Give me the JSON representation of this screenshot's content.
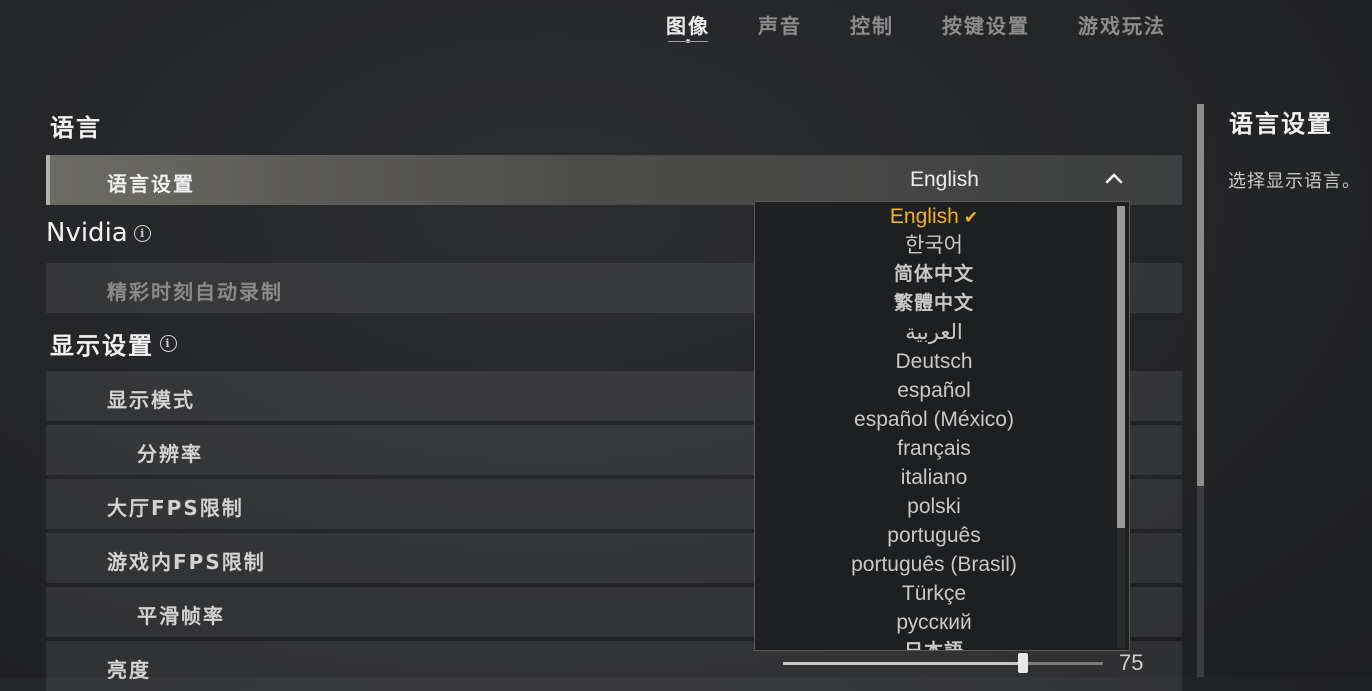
{
  "tabs": [
    {
      "label": "图像",
      "active": true
    },
    {
      "label": "声音",
      "active": false
    },
    {
      "label": "控制",
      "active": false
    },
    {
      "label": "按键设置",
      "active": false
    },
    {
      "label": "游戏玩法",
      "active": false
    }
  ],
  "sections": {
    "language": "语言",
    "nvidia": "Nvidia",
    "display": "显示设置"
  },
  "rows": {
    "language_setting": {
      "label": "语言设置",
      "value": "English"
    },
    "highlights_auto_record": "精彩时刻自动录制",
    "display_mode": "显示模式",
    "resolution": "分辨率",
    "lobby_fps_limit": "大厅FPS限制",
    "ingame_fps_limit": "游戏内FPS限制",
    "smooth_framerate": "平滑帧率",
    "brightness": {
      "label": "亮度",
      "value": "75",
      "level_percent": 75
    }
  },
  "language_options": [
    {
      "label": "English",
      "selected": true
    },
    {
      "label": "한국어"
    },
    {
      "label": "简体中文"
    },
    {
      "label": "繁體中文"
    },
    {
      "label": "العربية"
    },
    {
      "label": "Deutsch"
    },
    {
      "label": "español"
    },
    {
      "label": "español (México)"
    },
    {
      "label": "français"
    },
    {
      "label": "italiano"
    },
    {
      "label": "polski"
    },
    {
      "label": "português"
    },
    {
      "label": "português (Brasil)"
    },
    {
      "label": "Türkçe"
    },
    {
      "label": "русский"
    },
    {
      "label": "日本語"
    }
  ],
  "description": {
    "title": "语言设置",
    "text": "选择显示语言。"
  },
  "icons": {
    "info": "info-icon",
    "chevron": "chevron-up-icon",
    "check": "checkmark-icon"
  },
  "colors": {
    "accent_selected": "#f0b51e"
  }
}
